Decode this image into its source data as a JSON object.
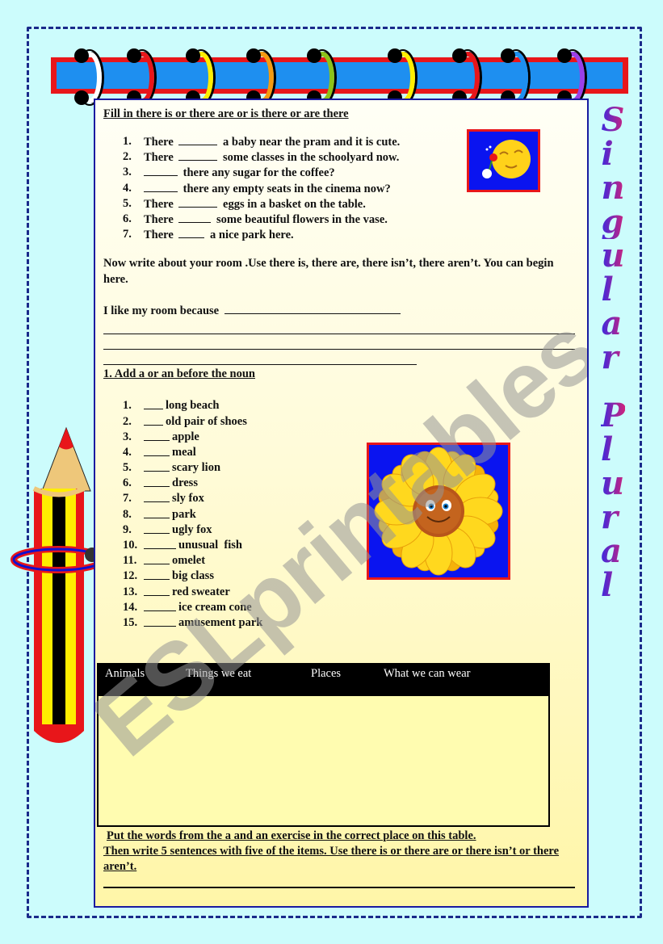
{
  "section1": {
    "heading": "Fill in there is or there are or is there or are there",
    "items": [
      {
        "num": "1.",
        "before": "There",
        "after": "a baby near the pram and it is cute.",
        "blank": 48
      },
      {
        "num": "2.",
        "before": "There",
        "after": "some classes in the schoolyard now.",
        "blank": 48
      },
      {
        "num": "3.",
        "before": "",
        "after": "there any sugar for the coffee?",
        "blank": 42
      },
      {
        "num": "4.",
        "before": "",
        "after": "there any empty seats in the cinema now?",
        "blank": 42
      },
      {
        "num": "5.",
        "before": "There",
        "after": "eggs in a basket on the table.",
        "blank": 48
      },
      {
        "num": "6.",
        "before": "There",
        "after": "some beautiful flowers in the vase.",
        "blank": 40
      },
      {
        "num": "7.",
        "before": "There",
        "after": "a nice park here.",
        "blank": 32
      }
    ]
  },
  "section2": {
    "instruction": "Now write about your room .Use there is, there are, there isn’t, there aren’t. You can begin here.",
    "prompt": "I like my room because"
  },
  "section3": {
    "heading": "1. Add a or an before the noun",
    "items": [
      {
        "num": "1.",
        "noun": "long beach",
        "blank": 24
      },
      {
        "num": "2.",
        "noun": "old pair of shoes",
        "blank": 24
      },
      {
        "num": "3.",
        "noun": "apple",
        "blank": 32
      },
      {
        "num": "4.",
        "noun": "meal",
        "blank": 32
      },
      {
        "num": "5.",
        "noun": "scary lion",
        "blank": 32
      },
      {
        "num": "6.",
        "noun": "dress",
        "blank": 32
      },
      {
        "num": "7.",
        "noun": "sly fox",
        "blank": 32
      },
      {
        "num": "8.",
        "noun": "park",
        "blank": 32
      },
      {
        "num": "9.",
        "noun": "ugly fox",
        "blank": 32
      },
      {
        "num": "10.",
        "noun": "unusual  fish",
        "blank": 40
      },
      {
        "num": "11.",
        "noun": "omelet",
        "blank": 32
      },
      {
        "num": "12.",
        "noun": "big class",
        "blank": 32
      },
      {
        "num": "13.",
        "noun": "red sweater",
        "blank": 32
      },
      {
        "num": "14.",
        "noun": "ice cream cone",
        "blank": 40
      },
      {
        "num": "15.",
        "noun": "amusement park",
        "blank": 40
      }
    ]
  },
  "table": {
    "columns": [
      "Animals",
      "Things we eat",
      "Places",
      "What we can wear"
    ]
  },
  "section4": {
    "line1": "Put the words from the a and an exercise in the correct place on this table.",
    "line2": "Then write 5 sentences with five of the items. Use there is or there are or there isn’t or there aren’t."
  },
  "side_title": {
    "word1": "Singular",
    "word2": "Plural"
  },
  "watermark": "ESLprintables.com",
  "rings": [
    "#ffffff",
    "#e8161a",
    "#ffee00",
    "#f59a10",
    "#8cc21a",
    "#ffee00",
    "#e8161a",
    "#1e8ff0",
    "#9a40e8"
  ],
  "colors": {
    "page_bg": "#ccfcfc",
    "frame": "#1a2a8a",
    "bar_red": "#e8161a",
    "bar_blue": "#1e8ff0",
    "image_bg": "#0a14f0"
  }
}
